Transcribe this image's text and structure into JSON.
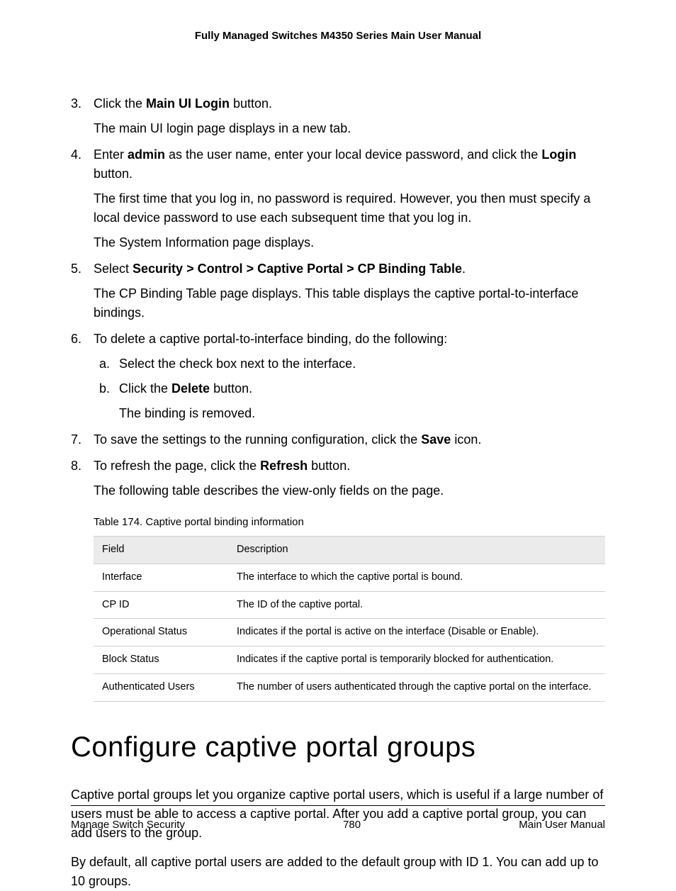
{
  "header": {
    "title": "Fully Managed Switches M4350 Series Main User Manual"
  },
  "steps": {
    "s3": {
      "prefix": "Click the ",
      "bold": "Main UI Login",
      "suffix": " button.",
      "desc": "The main UI login page displays in a new tab."
    },
    "s4": {
      "prefix": "Enter ",
      "bold1": "admin",
      "mid": " as the user name, enter your local device password, and click the ",
      "bold2": "Login",
      "suffix": " button.",
      "p1": "The first time that you log in, no password is required. However, you then must specify a local device password to use each subsequent time that you log in.",
      "p2": "The System Information page displays."
    },
    "s5": {
      "prefix": "Select ",
      "bold": "Security > Control > Captive Portal > CP Binding Table",
      "suffix": ".",
      "desc": "The CP Binding Table page displays. This table displays the captive portal-to-interface bindings."
    },
    "s6": {
      "text": "To delete a captive portal-to-interface binding, do the following:",
      "a": "Select the check box next to the interface.",
      "b_prefix": "Click the ",
      "b_bold": "Delete",
      "b_suffix": " button.",
      "b_desc": "The binding is removed."
    },
    "s7": {
      "prefix": "To save the settings to the running configuration, click the ",
      "bold": "Save",
      "suffix": " icon."
    },
    "s8": {
      "prefix": "To refresh the page, click the ",
      "bold": "Refresh",
      "suffix": " button.",
      "desc": "The following table describes the view-only fields on the page."
    }
  },
  "table": {
    "caption": "Table 174. Captive portal binding information",
    "head": {
      "c1": "Field",
      "c2": "Description"
    },
    "rows": [
      {
        "c1": "Interface",
        "c2": "The interface to which the captive portal is bound."
      },
      {
        "c1": "CP ID",
        "c2": "The ID of the captive portal."
      },
      {
        "c1": "Operational Status",
        "c2": "Indicates if the portal is active on the interface (Disable or Enable)."
      },
      {
        "c1": "Block Status",
        "c2": "Indicates if the captive portal is temporarily blocked for authentication."
      },
      {
        "c1": "Authenticated Users",
        "c2": "The number of users authenticated through the captive portal on the interface."
      }
    ]
  },
  "section": {
    "heading": "Configure captive portal groups",
    "p1": "Captive portal groups let you organize captive portal users, which is useful if a large number of users must be able to access a captive portal. After you add a captive portal group, you can add users to the group.",
    "p2": "By default, all captive portal users are added to the default group with ID 1. You can add up to 10 groups."
  },
  "footer": {
    "left": "Manage Switch Security",
    "center": "780",
    "right": "Main User Manual"
  }
}
